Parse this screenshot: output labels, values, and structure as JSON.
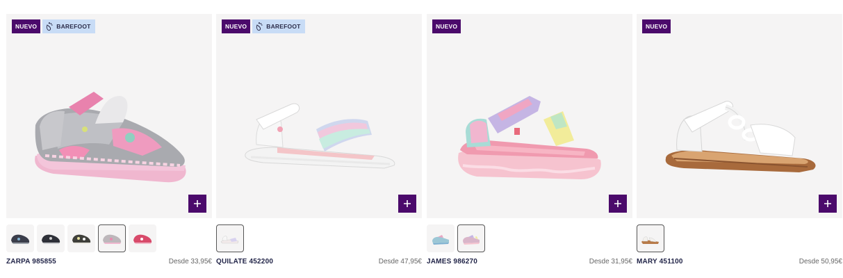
{
  "products": [
    {
      "badges": {
        "new": "NUEVO",
        "barefoot": "BAREFOOT"
      },
      "name": "ZARPA 985855",
      "price": "Desde 33,95€",
      "variant_colors": [
        "#3a3d4a",
        "#2e3038",
        "#3f3f3a",
        "#d8b6c4",
        "#d84a6a"
      ],
      "selected_variant": 4
    },
    {
      "badges": {
        "new": "NUEVO",
        "barefoot": "BAREFOOT"
      },
      "name": "QUILATE 452200",
      "price": "Desde 47,95€",
      "variant_colors": [
        "#f2eaea"
      ],
      "selected_variant": 1
    },
    {
      "badges": {
        "new": "NUEVO"
      },
      "name": "JAMES 986270",
      "price": "Desde 31,95€",
      "variant_colors": [
        "#9cc7d6",
        "#d9b5c9"
      ],
      "selected_variant": 2
    },
    {
      "badges": {
        "new": "NUEVO"
      },
      "name": "MARY 451100",
      "price": "Desde 50,95€",
      "variant_colors": [
        "#f3f1ee"
      ],
      "selected_variant": 1
    }
  ],
  "icons": {
    "add": "plus-icon",
    "barefoot": "footprint-icon"
  },
  "colors": {
    "accent": "#4b0a6b",
    "barefoot_badge": "#c8dcf6",
    "card_bg": "#f5f4f4"
  }
}
